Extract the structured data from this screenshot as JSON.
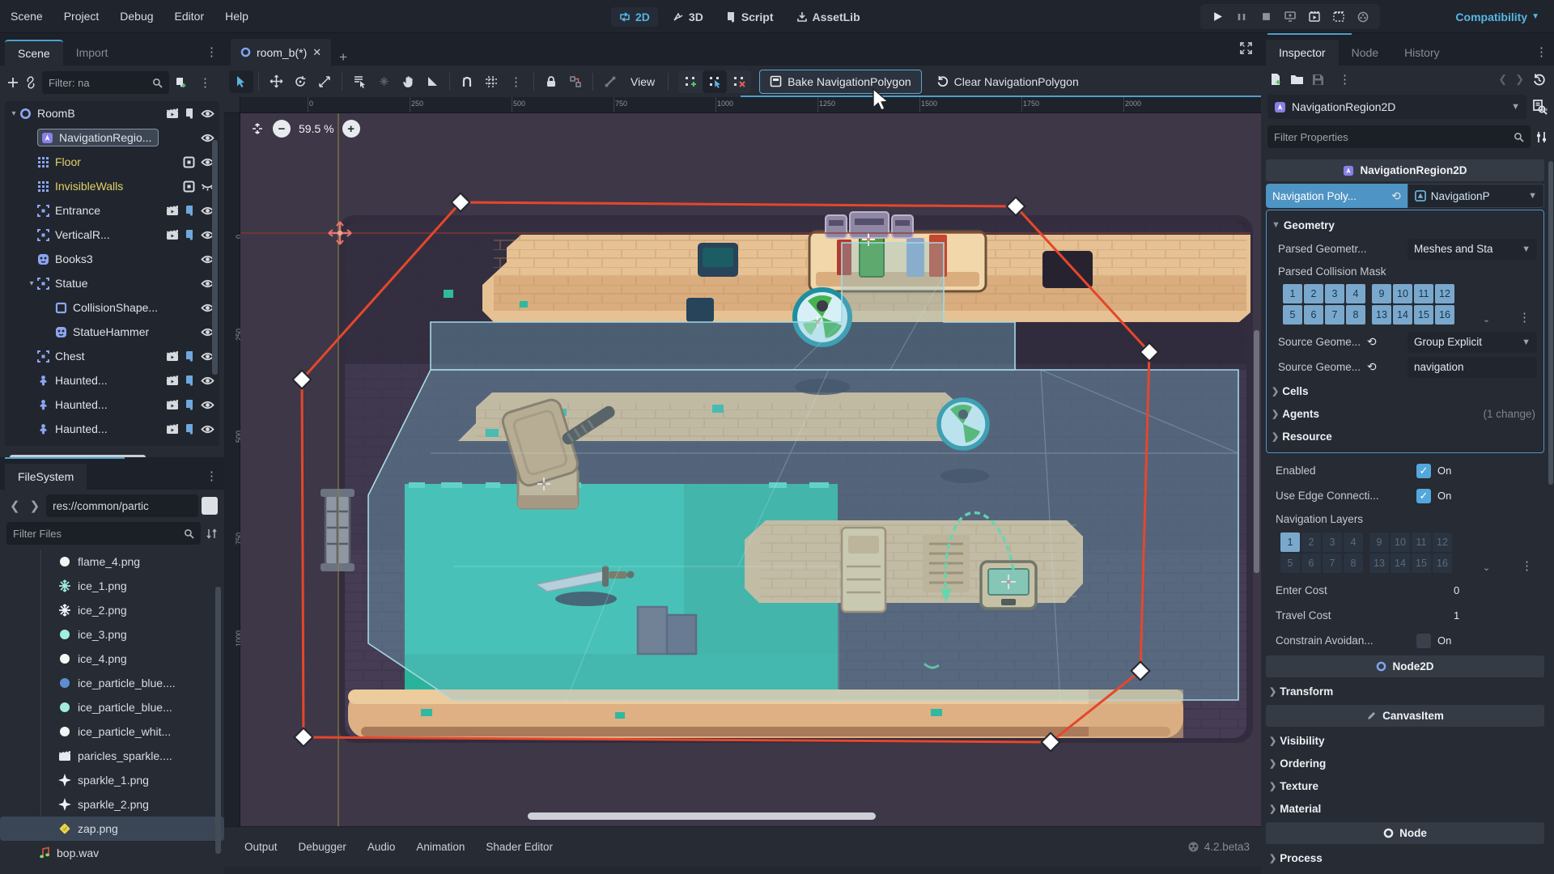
{
  "menu": {
    "items": [
      "Scene",
      "Project",
      "Debug",
      "Editor",
      "Help"
    ],
    "workspaces": [
      "2D",
      "3D",
      "Script",
      "AssetLib"
    ],
    "renderer": "Compatibility"
  },
  "scene_dock": {
    "tabs": [
      "Scene",
      "Import"
    ],
    "filter_placeholder": "Filter: na",
    "nodes": [
      {
        "name": "RoomB",
        "icon": "node2d",
        "depth": 0,
        "caret": "v",
        "trail": [
          "movie",
          "script",
          "eye"
        ]
      },
      {
        "name": "NavigationRegio...",
        "icon": "navregion",
        "depth": 1,
        "selected": true,
        "trail": [
          "eye"
        ]
      },
      {
        "name": "Floor",
        "icon": "tilemap",
        "depth": 1,
        "color": "yellow",
        "trail": [
          "tileset",
          "eye"
        ]
      },
      {
        "name": "InvisibleWalls",
        "icon": "tilemap",
        "depth": 1,
        "color": "yellow",
        "trail": [
          "tileset",
          "eyeoff"
        ]
      },
      {
        "name": "Entrance",
        "icon": "frame",
        "depth": 1,
        "trail": [
          "movie",
          "scriptb",
          "eye"
        ]
      },
      {
        "name": "VerticalR...",
        "icon": "frame",
        "depth": 1,
        "trail": [
          "movie",
          "scriptb",
          "eye"
        ]
      },
      {
        "name": "Books3",
        "icon": "sprite",
        "depth": 1,
        "trail": [
          "eye"
        ]
      },
      {
        "name": "Statue",
        "icon": "frame",
        "depth": 1,
        "caret": "v",
        "trail": [
          "eye"
        ]
      },
      {
        "name": "CollisionShape...",
        "icon": "shape",
        "depth": 2,
        "trail": [
          "eye"
        ]
      },
      {
        "name": "StatueHammer",
        "icon": "sprite",
        "depth": 2,
        "trail": [
          "eye"
        ]
      },
      {
        "name": "Chest",
        "icon": "frame",
        "depth": 1,
        "trail": [
          "movie",
          "scriptb",
          "eye"
        ]
      },
      {
        "name": "Haunted...",
        "icon": "person",
        "depth": 1,
        "trail": [
          "movie",
          "scriptb",
          "eye"
        ]
      },
      {
        "name": "Haunted...",
        "icon": "person",
        "depth": 1,
        "trail": [
          "movie",
          "scriptb",
          "eye"
        ]
      },
      {
        "name": "Haunted...",
        "icon": "person",
        "depth": 1,
        "trail": [
          "movie",
          "scriptb",
          "eye"
        ]
      }
    ]
  },
  "filesystem": {
    "title": "FileSystem",
    "path": "res://common/partic",
    "filter_placeholder": "Filter Files",
    "files": [
      {
        "name": "flame_4.png",
        "icon": "circle",
        "color": "#f3f5f4",
        "depth": 2
      },
      {
        "name": "ice_1.png",
        "icon": "snowflake",
        "color": "#9fe9e0",
        "depth": 2
      },
      {
        "name": "ice_2.png",
        "icon": "snowflake",
        "color": "#f2f5f6",
        "depth": 2
      },
      {
        "name": "ice_3.png",
        "icon": "circle",
        "color": "#9ff0dd",
        "depth": 2
      },
      {
        "name": "ice_4.png",
        "icon": "circle",
        "color": "#f4f7f6",
        "depth": 2
      },
      {
        "name": "ice_particle_blue....",
        "icon": "circle",
        "color": "#5b8fd0",
        "depth": 2
      },
      {
        "name": "ice_particle_blue...",
        "icon": "circle",
        "color": "#a2ecdc",
        "depth": 2
      },
      {
        "name": "ice_particle_whit...",
        "icon": "circle",
        "color": "#f2f4f5",
        "depth": 2
      },
      {
        "name": "paricles_sparkle....",
        "icon": "clapper",
        "color": "#e6eaee",
        "depth": 2
      },
      {
        "name": "sparkle_1.png",
        "icon": "star",
        "color": "#f1f3f5",
        "depth": 2
      },
      {
        "name": "sparkle_2.png",
        "icon": "star",
        "color": "#eef1f3",
        "depth": 2
      },
      {
        "name": "zap.png",
        "icon": "diamond",
        "color": "#e9d44a",
        "depth": 2,
        "selected": true
      },
      {
        "name": "bop.wav",
        "icon": "note",
        "color": "#8fd35f",
        "depth": 1
      }
    ]
  },
  "center": {
    "tab": "room_b(*)",
    "view_label": "View",
    "bake_label": "Bake NavigationPolygon",
    "clear_label": "Clear NavigationPolygon",
    "zoom": "59.5 %",
    "ruler_top": [
      "0",
      "250",
      "500",
      "750",
      "1000",
      "1250",
      "1500",
      "1750",
      "2000"
    ],
    "ruler_left": [
      "0",
      "250",
      "500",
      "750",
      "1000"
    ]
  },
  "bottom": {
    "items": [
      "Output",
      "Debugger",
      "Audio",
      "Animation",
      "Shader Editor"
    ],
    "version": "4.2.beta3"
  },
  "inspector": {
    "tabs": [
      "Inspector",
      "Node",
      "History"
    ],
    "object_name": "NavigationRegion2D",
    "filter_placeholder": "Filter Properties",
    "header": "NavigationRegion2D",
    "nav_poly": {
      "label": "Navigation Poly...",
      "value": "NavigationP"
    },
    "geometry": {
      "title": "Geometry",
      "parsed_geometry_label": "Parsed Geometr...",
      "parsed_geometry_value": "Meshes and Sta",
      "mask_label": "Parsed Collision Mask",
      "mask_rows": [
        [
          "1",
          "2",
          "3",
          "4",
          "9",
          "10",
          "11",
          "12"
        ],
        [
          "5",
          "6",
          "7",
          "8",
          "13",
          "14",
          "15",
          "16"
        ]
      ],
      "mask_selected": [
        "1",
        "2",
        "3",
        "4",
        "5",
        "6",
        "7",
        "8",
        "9",
        "10",
        "11",
        "12",
        "13",
        "14",
        "15",
        "16"
      ],
      "source_mode_label": "Source Geome...",
      "source_mode_value": "Group Explicit",
      "source_group_label": "Source Geome...",
      "source_group_value": "navigation",
      "cells": "Cells",
      "agents": "Agents",
      "agents_note": "(1 change)",
      "resource": "Resource"
    },
    "props": {
      "enabled_label": "Enabled",
      "enabled_value": "On",
      "edge_label": "Use Edge Connecti...",
      "edge_value": "On",
      "layers_label": "Navigation Layers",
      "layers_rows": [
        [
          "1",
          "2",
          "3",
          "4",
          "9",
          "10",
          "11",
          "12"
        ],
        [
          "5",
          "6",
          "7",
          "8",
          "13",
          "14",
          "15",
          "16"
        ]
      ],
      "layers_selected": [
        "1"
      ],
      "enter_cost_label": "Enter Cost",
      "enter_cost_value": "0",
      "travel_cost_label": "Travel Cost",
      "travel_cost_value": "1",
      "constrain_label": "Constrain Avoidan...",
      "constrain_value": "On"
    },
    "sections": {
      "node2d": "Node2D",
      "transform": "Transform",
      "canvasitem": "CanvasItem",
      "visibility": "Visibility",
      "ordering": "Ordering",
      "texture": "Texture",
      "material": "Material",
      "node": "Node",
      "process": "Process"
    }
  }
}
